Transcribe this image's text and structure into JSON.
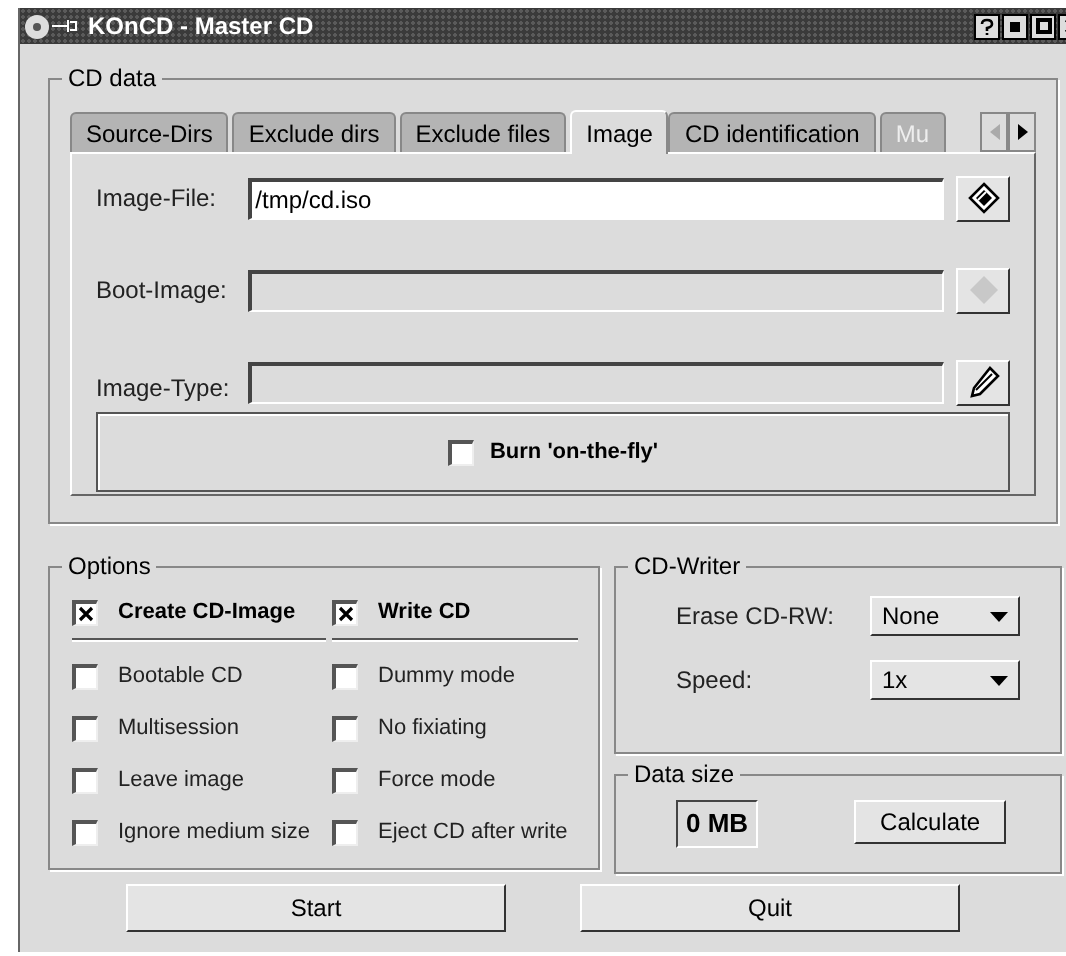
{
  "window": {
    "title": "KOnCD - Master CD"
  },
  "cd_data": {
    "title": "CD data",
    "tabs": [
      {
        "label": "Source-Dirs",
        "selected": false,
        "disabled": false
      },
      {
        "label": "Exclude dirs",
        "selected": false,
        "disabled": false
      },
      {
        "label": "Exclude files",
        "selected": false,
        "disabled": false
      },
      {
        "label": "Image",
        "selected": true,
        "disabled": false
      },
      {
        "label": "CD identification",
        "selected": false,
        "disabled": false
      },
      {
        "label": "Mu",
        "selected": false,
        "disabled": true
      }
    ],
    "fields": [
      {
        "label": "Image-File:",
        "value": "/tmp/cd.iso",
        "disabled": false,
        "kind": "diamond"
      },
      {
        "label": "Boot-Image:",
        "disabled": true,
        "kind": "diamond"
      },
      {
        "label": "Image-Type:",
        "disabled": true,
        "kind": "pencil"
      }
    ],
    "burn_on_the_fly": {
      "label": "Burn 'on-the-fly'",
      "checked": false
    }
  },
  "options": {
    "title": "Options",
    "primary": [
      {
        "label": "Create CD-Image",
        "checked": true
      },
      {
        "label": "Write CD",
        "checked": true
      }
    ],
    "items": [
      {
        "label": "Bootable CD",
        "checked": false
      },
      {
        "label": "Dummy mode",
        "checked": false
      },
      {
        "label": "Multisession",
        "checked": false
      },
      {
        "label": "No fixiating",
        "checked": false
      },
      {
        "label": "Leave image",
        "checked": false
      },
      {
        "label": "Force mode",
        "checked": false
      },
      {
        "label": "Ignore medium size",
        "checked": false
      },
      {
        "label": "Eject CD after write",
        "checked": false
      }
    ]
  },
  "cd_writer": {
    "title": "CD-Writer",
    "fields": [
      {
        "label": "Erase CD-RW:",
        "value": "None"
      },
      {
        "label": "Speed:",
        "value": "1x"
      }
    ]
  },
  "data_size": {
    "title": "Data size",
    "value": "0 MB",
    "button": "Calculate"
  },
  "buttons": [
    "Start",
    "Quit"
  ]
}
